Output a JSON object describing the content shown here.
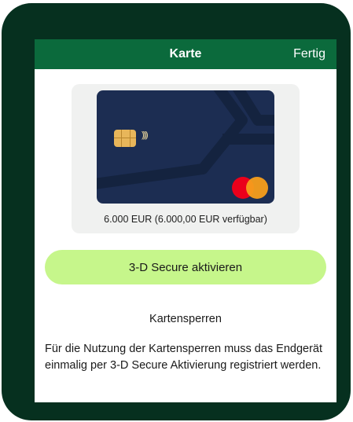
{
  "header": {
    "title": "Karte",
    "done_label": "Fertig"
  },
  "card": {
    "limit_text": "6.000 EUR (6.000,00 EUR verfügbar)",
    "network": "mastercard",
    "contactless_symbol": "))))"
  },
  "actions": {
    "secure_label": "3-D Secure aktivieren"
  },
  "card_lock": {
    "title": "Kartensperren",
    "description": "Für die Nutzung der Kartensperren muss das Endgerät einmalig per 3-D Secure Aktivierung registriert werden."
  },
  "colors": {
    "frame": "#06301f",
    "navbar": "#0b6a3c",
    "card": "#1c2d52",
    "accent_button": "#c6f68b"
  }
}
